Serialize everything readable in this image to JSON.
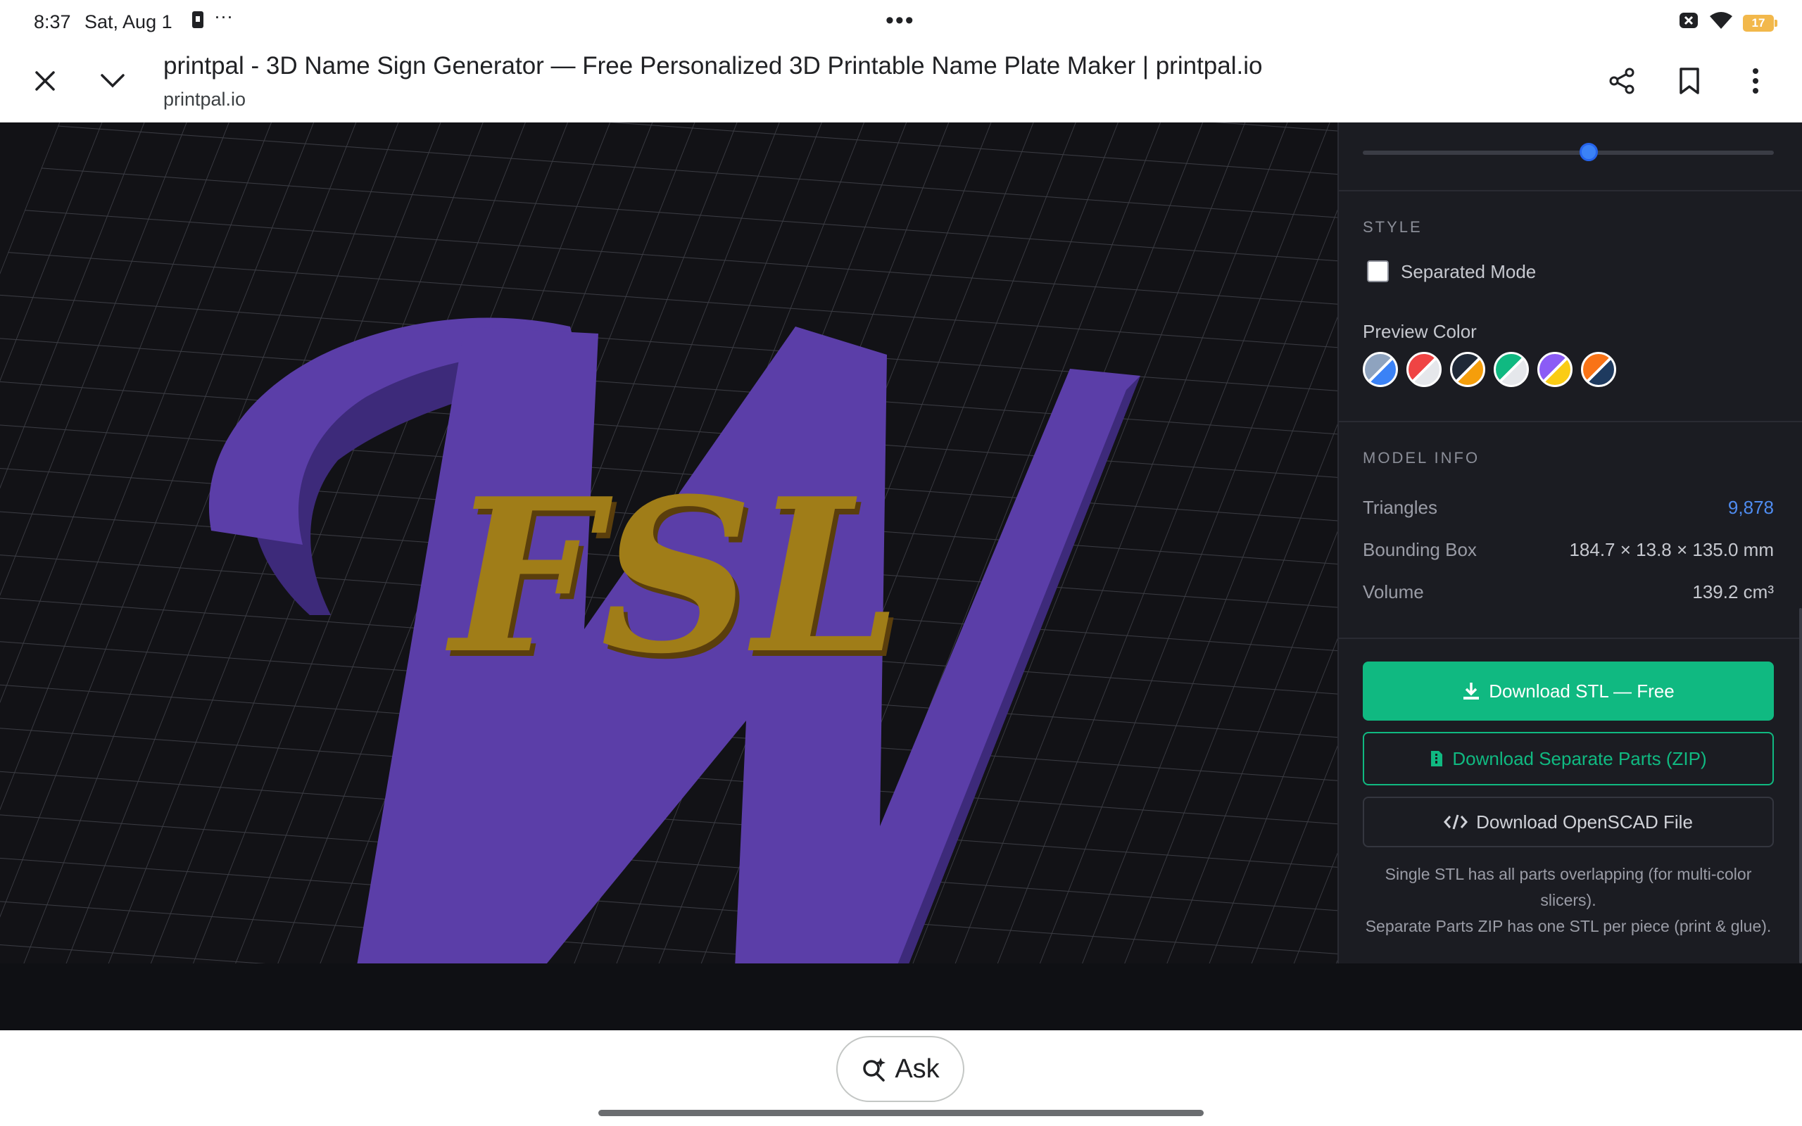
{
  "status_bar": {
    "time": "8:37",
    "date": "Sat, Aug 1",
    "menu_dots": "···",
    "center_dots": "•••",
    "battery": "17"
  },
  "browser": {
    "title": "printpal - 3D Name Sign Generator — Free Personalized 3D Printable Name Plate Maker | printpal.io",
    "domain": "printpal.io"
  },
  "viewport": {
    "big_letter": "W",
    "overlay_text": "FSL",
    "colors": {
      "grid_bg": "#121216",
      "base": "#5b3ea8",
      "text": "#a07d18"
    }
  },
  "panel": {
    "slider_fraction": 0.55,
    "style": {
      "title": "STYLE",
      "separated_mode_label": "Separated Mode",
      "separated_mode_checked": false,
      "preview_color_label": "Preview Color",
      "swatches": [
        {
          "a": "#8ea3bf",
          "b": "#3b82f6"
        },
        {
          "a": "#ef4444",
          "b": "#e5e7eb"
        },
        {
          "a": "#1f2937",
          "b": "#f59e0b"
        },
        {
          "a": "#10b981",
          "b": "#e5e7eb"
        },
        {
          "a": "#8b5cf6",
          "b": "#facc15"
        },
        {
          "a": "#f97316",
          "b": "#1e3a5f"
        }
      ]
    },
    "model_info": {
      "title": "MODEL INFO",
      "rows": [
        {
          "label": "Triangles",
          "value": "9,878"
        },
        {
          "label": "Bounding Box",
          "value": "184.7 × 13.8 × 135.0 mm"
        },
        {
          "label": "Volume",
          "value": "139.2 cm³"
        }
      ]
    },
    "buttons": {
      "download_stl": "Download STL — Free",
      "download_parts": "Download Separate Parts (ZIP)",
      "download_scad": "Download OpenSCAD File"
    },
    "notes": [
      "Single STL has all parts overlapping (for multi-color slicers).",
      "Separate Parts ZIP has one STL per piece (print & glue)."
    ]
  },
  "bottom": {
    "ask_label": "Ask"
  },
  "accent": {
    "green": "#10b981",
    "blue": "#3b82f6"
  }
}
